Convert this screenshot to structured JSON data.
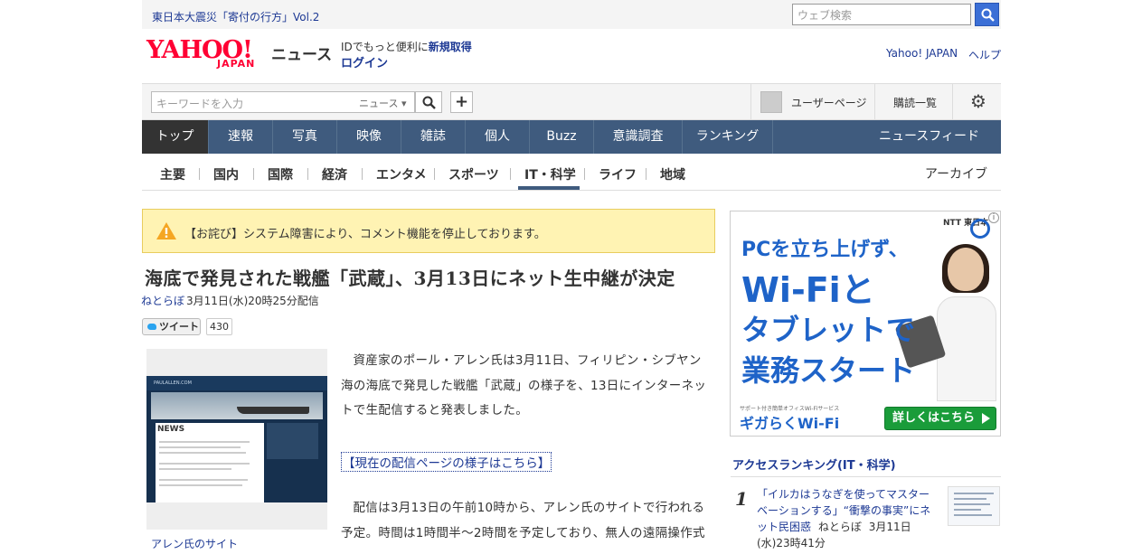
{
  "topbar": {
    "promo": "東日本大震災「寄付の行方」Vol.2",
    "search_placeholder": "ウェブ検索"
  },
  "header": {
    "logo": "YAHOO!",
    "logo_sub": "JAPAN",
    "service": "ニュース",
    "id_prefix": "IDでもっと便利に",
    "id_register": "新規取得",
    "login": "ログイン",
    "yahoo_japan": "Yahoo! JAPAN",
    "help": "ヘルプ"
  },
  "keyword_bar": {
    "placeholder": "キーワードを入力",
    "scope": "ニュース",
    "user_page": "ユーザーページ",
    "subscribe": "購読一覧"
  },
  "main_nav": {
    "items": [
      "トップ",
      "速報",
      "写真",
      "映像",
      "雑誌",
      "個人",
      "Buzz",
      "意識調査",
      "ランキング"
    ],
    "feed": "ニュースフィード"
  },
  "sub_nav": {
    "items": [
      "主要",
      "国内",
      "国際",
      "経済",
      "エンタメ",
      "スポーツ",
      "IT・科学",
      "ライフ",
      "地域"
    ],
    "archive": "アーカイブ"
  },
  "notice": {
    "text": "【お詫び】システム障害により、コメント機能を停止しております。"
  },
  "article": {
    "headline": "海底で発見された戦艦「武蔵」、3月13日にネット生中継が決定",
    "source": "ねとらぼ",
    "date": "3月11日(水)20時25分配信",
    "tweet_label": "ツイート",
    "tweet_count": "430",
    "photo_caption": "アレン氏のサイト",
    "photo_screen_logo": "PAULALLEN.COM",
    "photo_screen_heading": "NEWS",
    "para1": "資産家のポール・アレン氏は3月11日、フィリピン・シブヤン海の海底で発見した戦艦「武蔵」の様子を、13日にインターネットで生配信すると発表しました。",
    "live_link": "【現在の配信ページの様子はこちら】",
    "para2": "配信は3月13日の午前10時から、アレン氏のサイトで行われる予定。時間は1時間半〜2時間を予定しており、無人の遠隔操作式"
  },
  "ad": {
    "ntt": "NTT 東日本",
    "line1": "PCを立ち上げず、",
    "line2": "Wi-Fiと",
    "line3": "タブレットで",
    "line4": "業務スタート",
    "small": "サポート付き簡単オフィスWi-Fiサービス",
    "brand": "ギガらくWi-Fi",
    "cta": "詳しくはこちら"
  },
  "ranking": {
    "title": "アクセスランキング(IT・科学)",
    "items": [
      {
        "rank": "1",
        "title": "「イルカはうなぎを使ってマスターベーションする」“衝撃の事実”にネット民困惑",
        "source": "ねとらぼ",
        "date": "3月11日(水)23時41分"
      }
    ]
  },
  "colors": {
    "nav": "#3f5b7e",
    "link": "#1d3994",
    "notice_bg": "#fff3b3",
    "yahoo_red": "#ff0033"
  }
}
